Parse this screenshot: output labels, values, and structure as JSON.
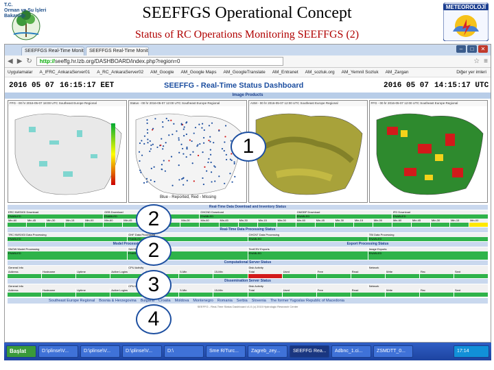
{
  "slide": {
    "title": "SEEFFGS Operational Concept",
    "subtitle": "Status of RC Operations Monitoring SEEFFGS (2)",
    "logo_left_text": "T.C.\nOrman ve Su İşleri\nBakanlığı",
    "logo_right_text": "METEOROLOJİ"
  },
  "browser": {
    "tabs": [
      {
        "label": "SEEFFGS Real-Time Monitor"
      },
      {
        "label": "SEEFFGS Real-Time Monito"
      }
    ],
    "url_prefix": "http://",
    "url": "seeffg.hr.lzb.org/DASHBOARD/index.php?region=0",
    "bookmarks": [
      "Uygulamalar",
      "A_IFRC_AnkaraServer01",
      "A_RC_AnkaraServer02",
      "AM_Google",
      "AM_Google Maps",
      "AM_GoogleTranslate",
      "AM_Entranet",
      "AM_sozluk.org",
      "AM_Yemnil Sozluk",
      "AM_Zargan"
    ],
    "bookmarks_right": "Diğer yer imleri"
  },
  "dashboard": {
    "date_left": "2016 05 07",
    "time_left": "16:15:17 EET",
    "title": "SEEFFG - Real-Time Status Dashboard",
    "date_right": "2016 05 07",
    "time_right": "14:15:17 UTC",
    "image_products_label": "Image Products",
    "maps": [
      {
        "caption": "FFG - 00 hr   2016-05-07 18:00 UTC   Southeast Europe Regional"
      },
      {
        "caption": "Status - 00 hr   2016-05-07 12:00 UTC   Southeast Europe Regional"
      },
      {
        "caption": "ASM - 00 hr   2016-05-07 12:00 UTC   Southeast Europe Regional"
      },
      {
        "caption": "FFG - 00 hr   2016-05-07 12:00 UTC   Southeast Europe Regional"
      }
    ],
    "map_footer_center": "Blue - Reported, Red - Missing",
    "sections": {
      "download": "Real-Time Data Download and Inventory Status",
      "processing": "Real-Time Data Processing Status",
      "model": "Model Processing",
      "export": "Export Processing Status",
      "computational": "Computational Server Status",
      "dissemination": "Dissemination Server Status"
    },
    "download_headers": [
      "ERC NWS/IGI Download",
      "GEB Download",
      "GHCND Download",
      "GMGBP Download",
      "IFD Download"
    ],
    "download_status": "ENABLED",
    "row_min_labels": [
      "Min-60",
      "Min-45",
      "Min-30",
      "Min-15",
      "Min-00"
    ],
    "processing_headers": [
      "TRC NWS/IGI Data Processing",
      "GHF Data Processing",
      "GHCNT Data Processing",
      "TBI Data Processing"
    ],
    "model_headers": [
      "SNOW Model Processing",
      "SACSMA & ILM Model Processing",
      "TextCSV Exports",
      "Image Exports"
    ],
    "server_headers": [
      "Address",
      "Hostname",
      "Uptime",
      "Active Logins",
      "1-Min",
      "5-Min",
      "15-Min",
      "Total",
      "Used",
      "Free",
      "Read",
      "Write",
      "Rec",
      "Sent"
    ],
    "server_labels": [
      "General Info",
      "CPU Activity",
      "Disk Activity",
      "Network"
    ],
    "footer_links": [
      "Southeast Europe Regional",
      "Bosnia & Herzegovina",
      "Bulgaria",
      "Croatia",
      "Moldova",
      "Montenegro",
      "Romania",
      "Serbia",
      "Slovenia",
      "The former Yugoslav Republic of Macedonia"
    ],
    "copyright": "SEEFFG - Real-Time Status Dashboard v1.0 (c) 2015 Hydrologic Research Center"
  },
  "badges": [
    "1",
    "2",
    "2",
    "3",
    "4"
  ],
  "taskbar": {
    "start": "Başlat",
    "items": [
      "D:\\plinse\\V...",
      "D:\\plinse\\V...",
      "D:\\plinse\\V...",
      "D:\\",
      "Sme R/Turc...",
      "Zagreb_zey...",
      "SEEFFG Rea...",
      "Adbnc_1.ci...",
      "ZSMDTT_0..."
    ],
    "active_index": 6,
    "clock": "17:14"
  },
  "colors": {
    "accent": "#1d4fa0",
    "ok": "#2fb34a",
    "warn": "#ffe800",
    "error": "#d21a1a",
    "subtitle": "#b00000"
  }
}
